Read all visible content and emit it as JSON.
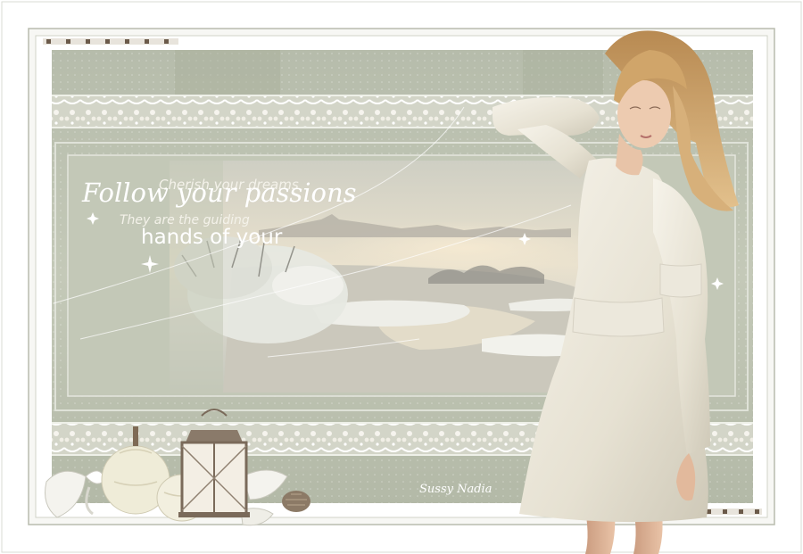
{
  "artwork": {
    "quote": {
      "line1": "Cherish your dreams",
      "line2": "Follow your passions",
      "line3": "They are the guiding",
      "line4": "hands of your"
    },
    "signature": "Sussy Nadia",
    "colors": {
      "frame": "#ffffff",
      "sage": "#b9bfae",
      "sage_dark": "#9ea58f",
      "lace": "#f3f1ea",
      "dress": "#f1eee4",
      "hair": "#c79a5e",
      "skin": "#e8c4a8",
      "sky": "#e8dcc9",
      "water": "#c9c7bd"
    },
    "icons": [
      "lantern-icon",
      "pumpkin-icon",
      "pinecone-icon",
      "leaf-icon",
      "bow-icon"
    ]
  }
}
